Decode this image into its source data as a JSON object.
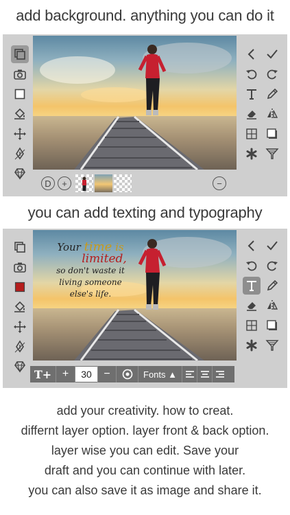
{
  "headings": {
    "top": "add background. anything you can do it",
    "middle": "you can add texting and typography"
  },
  "layer_bar": {
    "delete_label": "D",
    "add_label": "+",
    "minus_label": "−"
  },
  "text_toolbar": {
    "font_size": "30",
    "plus_label": "+",
    "minus_label": "−",
    "fonts_label": "Fonts ▲",
    "text_icon_label": "T+"
  },
  "quote": {
    "line1a": "Your ",
    "line1b": "time",
    "line1c": " is",
    "line2": "limited,",
    "line3": "so don't waste it",
    "line4": "living someone",
    "line5": "else's life."
  },
  "description": {
    "lines": [
      "add your creativity. how to creat.",
      "differnt layer option. layer front & back option.",
      "layer wise you can edit. Save your",
      "draft and you can continue with later.",
      "you can also save it as image and share it."
    ]
  },
  "colors": {
    "panel_bg": "#cfcfcf",
    "toolbar_bg": "#6f6f6f",
    "swatch_red": "#b51d1d",
    "quote_gold": "#c79a1c",
    "quote_red": "#b51d1d"
  },
  "icons": {
    "left_column": [
      "layers-icon",
      "camera-icon",
      "square-icon",
      "paint-bucket-icon",
      "move-icon",
      "pen-nib-icon",
      "diamond-icon"
    ],
    "right_column": [
      "back-icon",
      "check-icon",
      "undo-icon",
      "redo-icon",
      "text-icon",
      "pencil-icon",
      "eraser-icon",
      "flip-icon",
      "grid-icon",
      "shadow-icon",
      "asterisk-icon",
      "filter-icon"
    ]
  }
}
